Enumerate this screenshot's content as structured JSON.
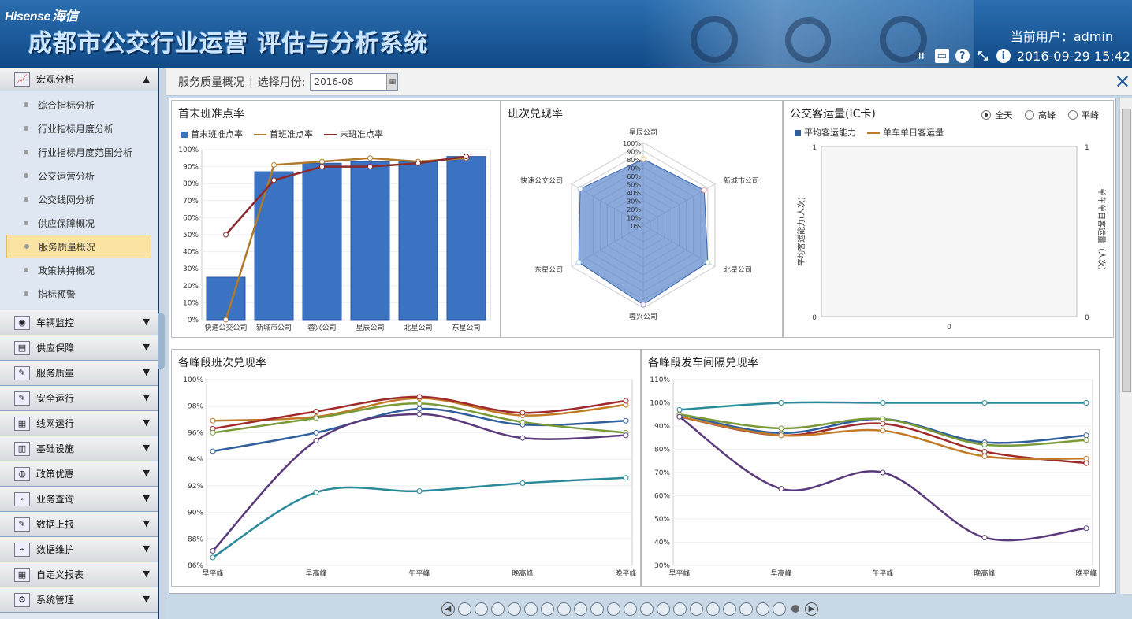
{
  "header": {
    "logo_brand": "Hisense",
    "logo_cn": "海信",
    "system_title": "成都市公交行业运营 评估与分析系统",
    "current_user_label": "当前用户：",
    "current_user": "admin",
    "datetime": "2016-09-29 15:42"
  },
  "sidebar": {
    "sections": [
      {
        "label": "宏观分析",
        "expanded": true,
        "icon": "chart-line-icon"
      },
      {
        "label": "车辆监控",
        "icon": "camera-icon"
      },
      {
        "label": "供应保障",
        "icon": "supply-icon"
      },
      {
        "label": "服务质量",
        "icon": "edit-icon"
      },
      {
        "label": "安全运行",
        "icon": "edit-icon"
      },
      {
        "label": "线网运行",
        "icon": "calendar-icon"
      },
      {
        "label": "基础设施",
        "icon": "infrastructure-icon"
      },
      {
        "label": "政策优惠",
        "icon": "globe-icon"
      },
      {
        "label": "业务查询",
        "icon": "chart-icon"
      },
      {
        "label": "数据上报",
        "icon": "edit-icon"
      },
      {
        "label": "数据维护",
        "icon": "chart-icon"
      },
      {
        "label": "自定义报表",
        "icon": "calendar-icon"
      },
      {
        "label": "系统管理",
        "icon": "gear-icon"
      }
    ],
    "sub_items": [
      "综合指标分析",
      "行业指标月度分析",
      "行业指标月度范围分析",
      "公交运营分析",
      "公交线网分析",
      "供应保障概况",
      "服务质量概况",
      "政策扶持概况",
      "指标预警"
    ],
    "active_sub": "服务质量概况"
  },
  "topbar": {
    "breadcrumb": "服务质量概况",
    "separator": "|",
    "month_label": "选择月份:",
    "month_value": "2016-08"
  },
  "colors": {
    "bar": "#3b72c2",
    "first_bus": "#b07a2a",
    "last_bus": "#8b2a2a",
    "radar_fill": "#5a86cc",
    "s_blue": "#2f5e9c",
    "s_orange": "#c07a28",
    "s_red": "#a02a2a",
    "s_green": "#7a9a3a",
    "s_purple": "#5a3a7a",
    "s_teal": "#2a8a9a"
  },
  "panels": {
    "first_last": {
      "title": "首末班准点率"
    },
    "radar": {
      "title": "班次兑现率"
    },
    "passenger": {
      "title": "公交客运量(IC卡)",
      "radios": [
        {
          "label": "全天",
          "on": true
        },
        {
          "label": "高峰",
          "on": false
        },
        {
          "label": "平峰",
          "on": false
        }
      ]
    },
    "peak_trip": {
      "title": "各峰段班次兑现率"
    },
    "peak_interval": {
      "title": "各峰段发车间隔兑现率"
    }
  },
  "chart_data": [
    {
      "type": "bar",
      "title": "首末班准点率",
      "categories": [
        "快速公交公司",
        "新城市公司",
        "蓉兴公司",
        "星辰公司",
        "北星公司",
        "东星公司"
      ],
      "legend": [
        "首末班准点率",
        "首班准点率",
        "末班准点率"
      ],
      "series": [
        {
          "name": "首末班准点率",
          "values": [
            25,
            87,
            92,
            93,
            93,
            96
          ]
        },
        {
          "name": "首班准点率",
          "values": [
            0,
            91,
            93,
            95,
            93,
            95
          ]
        },
        {
          "name": "末班准点率",
          "values": [
            50,
            82,
            90,
            90,
            92,
            96
          ]
        }
      ],
      "ylim": [
        0,
        100
      ],
      "yticks": [
        "0%",
        "10%",
        "20%",
        "30%",
        "40%",
        "50%",
        "60%",
        "70%",
        "80%",
        "90%",
        "100%"
      ]
    },
    {
      "type": "radar",
      "title": "班次兑现率",
      "categories": [
        "星辰公司",
        "新城市公司",
        "北星公司",
        "蓉兴公司",
        "东星公司",
        "快速公交公司"
      ],
      "values": [
        80,
        85,
        90,
        96,
        90,
        88
      ],
      "rlim": [
        0,
        100
      ],
      "rticks": [
        "0%",
        "10%",
        "20%",
        "30%",
        "40%",
        "50%",
        "60%",
        "70%",
        "80%",
        "90%",
        "100%"
      ]
    },
    {
      "type": "bar",
      "title": "公交客运量(IC卡)",
      "legend": [
        "平均客运能力",
        "单车单日客运量"
      ],
      "ylabel_left": "平均客运能力(人次)",
      "ylabel_right": "单车单日客运量（人次）",
      "yticks_left": [
        "0",
        "1"
      ],
      "yticks_right": [
        "0",
        "1"
      ],
      "xticks": [
        "0"
      ],
      "series": []
    },
    {
      "type": "line",
      "title": "各峰段班次兑现率",
      "categories": [
        "早平峰",
        "早高峰",
        "午平峰",
        "晚高峰",
        "晚平峰"
      ],
      "ylim": [
        86,
        100
      ],
      "yticks": [
        "86%",
        "88%",
        "90%",
        "92%",
        "94%",
        "96%",
        "98%",
        "100%"
      ],
      "series": [
        {
          "values": [
            94.6,
            96.0,
            97.8,
            96.6,
            96.9
          ],
          "color": "s_blue"
        },
        {
          "values": [
            96.9,
            97.2,
            98.6,
            97.3,
            98.1
          ],
          "color": "s_orange"
        },
        {
          "values": [
            96.3,
            97.6,
            98.7,
            97.5,
            98.4
          ],
          "color": "s_red"
        },
        {
          "values": [
            96.0,
            97.1,
            98.2,
            96.8,
            96.0
          ],
          "color": "s_green"
        },
        {
          "values": [
            87.1,
            95.4,
            97.4,
            95.6,
            95.8
          ],
          "color": "s_purple"
        },
        {
          "values": [
            86.6,
            91.5,
            91.6,
            92.2,
            92.6
          ],
          "color": "s_teal"
        }
      ]
    },
    {
      "type": "line",
      "title": "各峰段发车间隔兑现率",
      "categories": [
        "早平峰",
        "早高峰",
        "午平峰",
        "晚高峰",
        "晚平峰"
      ],
      "ylim": [
        30,
        110
      ],
      "yticks": [
        "30%",
        "40%",
        "50%",
        "60%",
        "70%",
        "80%",
        "90%",
        "100%",
        "110%"
      ],
      "series": [
        {
          "values": [
            97,
            100,
            100,
            100,
            100
          ],
          "color": "s_teal"
        },
        {
          "values": [
            95,
            87,
            93,
            83,
            86
          ],
          "color": "s_blue"
        },
        {
          "values": [
            95,
            89,
            93,
            82,
            84
          ],
          "color": "s_green"
        },
        {
          "values": [
            94,
            86,
            91,
            79,
            74
          ],
          "color": "s_red"
        },
        {
          "values": [
            94,
            86,
            88,
            77,
            76
          ],
          "color": "s_orange"
        },
        {
          "values": [
            94,
            63,
            70,
            42,
            46
          ],
          "color": "s_purple"
        }
      ]
    }
  ],
  "pager": {
    "total": 21,
    "current": 21
  }
}
